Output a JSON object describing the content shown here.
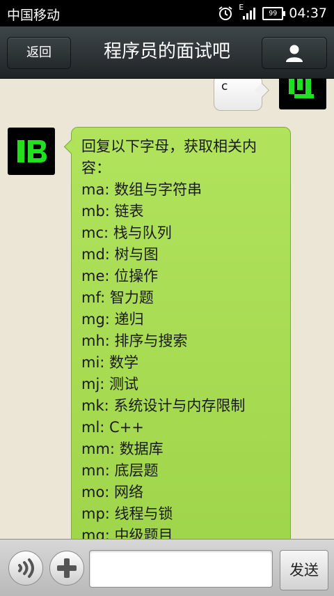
{
  "status_bar": {
    "carrier": "中国移动",
    "network": "E",
    "battery": "99",
    "time": "04:37"
  },
  "header": {
    "back_label": "返回",
    "title": "程序员的面试吧",
    "profile_icon": "person-icon"
  },
  "chat": {
    "outgoing_message": "c",
    "incoming_message": {
      "intro": "回复以下字母，获取相关内容：",
      "items": [
        "ma: 数组与字符串",
        "mb: 链表",
        "mc: 栈与队列",
        "md: 树与图",
        "me: 位操作",
        "mf: 智力题",
        "mg: 递归",
        "mh: 排序与搜索",
        "mi: 数学",
        "mj: 测试",
        "mk: 系统设计与内存限制",
        "ml: C++",
        "mm: 数据库",
        "mn: 底层题",
        "mo: 网络",
        "mp: 线程与锁",
        "mq: 中级题目"
      ]
    }
  },
  "input_bar": {
    "voice_icon": "voice-icon",
    "plus_icon": "plus-icon",
    "input_value": "",
    "send_label": "发送"
  },
  "colors": {
    "incoming_bubble": "#a8dc52",
    "avatar_accent": "#20e020"
  }
}
